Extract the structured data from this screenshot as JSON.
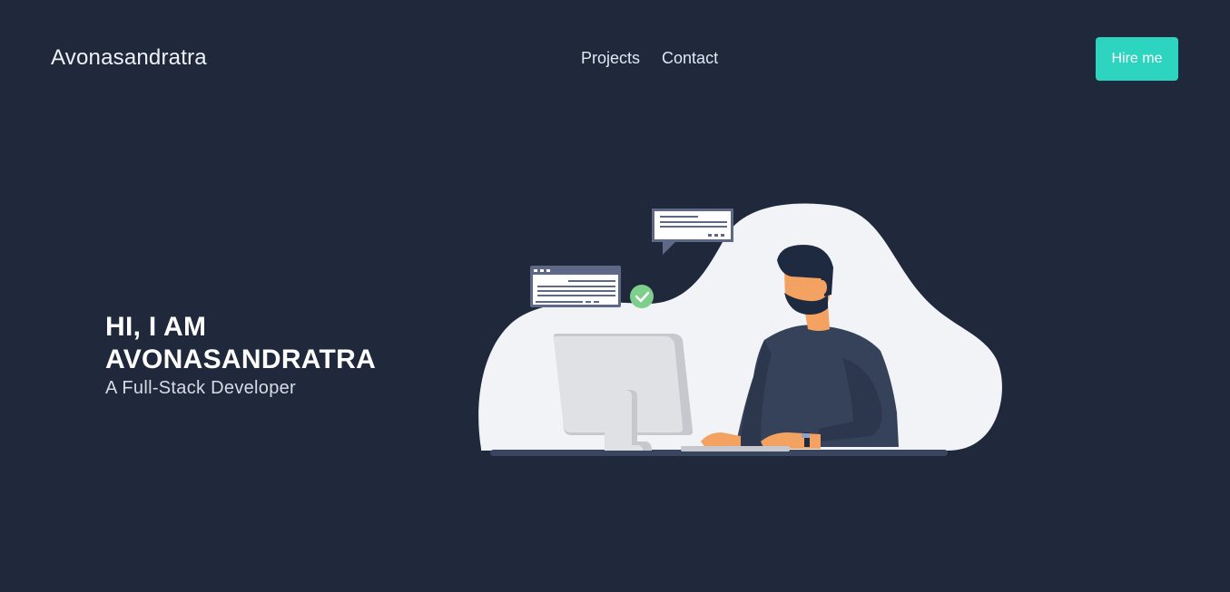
{
  "nav": {
    "brand": "Avonasandratra",
    "links": [
      "Projects",
      "Contact"
    ],
    "cta_label": "Hire me"
  },
  "hero": {
    "title_line1": "HI, I AM",
    "title_line2": "AVONASANDRATRA",
    "subtitle": "A Full-Stack Developer"
  },
  "colors": {
    "background": "#1f293b",
    "accent": "#2dd4bf",
    "blob": "#f1f3f7",
    "shirt": "#36415a",
    "skin": "#f4a261",
    "hair": "#1e2a40",
    "check": "#7dcf8b"
  },
  "illustration": {
    "name": "developer-at-computer-illustration"
  }
}
